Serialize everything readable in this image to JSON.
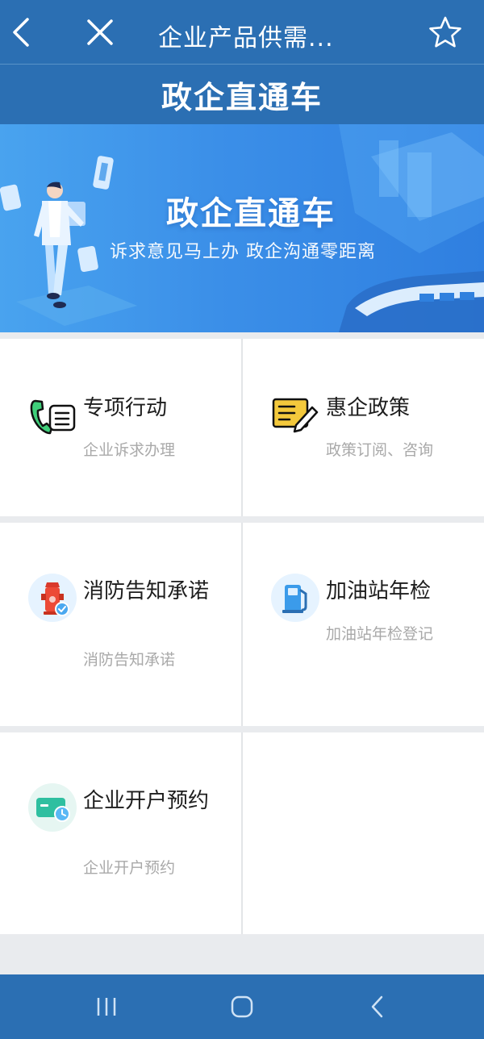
{
  "header": {
    "title": "企业产品供需..."
  },
  "subheader": {
    "title": "政企直通车"
  },
  "banner": {
    "title": "政企直通车",
    "subtitle": "诉求意见马上办   政企沟通零距离"
  },
  "services": [
    {
      "name": "专项行动",
      "desc": "企业诉求办理",
      "icon": "phone-document-icon"
    },
    {
      "name": "惠企政策",
      "desc": "政策订阅、咨询",
      "icon": "policy-edit-icon"
    },
    {
      "name": "消防告知承诺",
      "desc": "消防告知承诺",
      "icon": "fire-hydrant-icon"
    },
    {
      "name": "加油站年检",
      "desc": "加油站年检登记",
      "icon": "gas-pump-icon"
    },
    {
      "name": "企业开户预约",
      "desc": "企业开户预约",
      "icon": "card-clock-icon"
    }
  ],
  "colors": {
    "primary": "#2b6fb3",
    "banner": "#3b8fe8",
    "desc_text": "#a9a9a9"
  }
}
